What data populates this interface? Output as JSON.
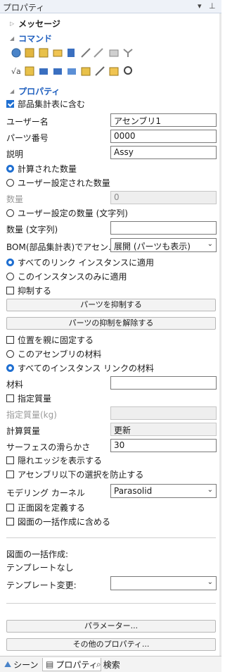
{
  "panel": {
    "title": "プロパティ",
    "pin_glyph": "▾ ⊥"
  },
  "sections": {
    "messages": "メッセージ",
    "commands": "コマンド",
    "properties": "プロパティ"
  },
  "icons_row1": [
    "globe-icon",
    "pencil-icon",
    "hierarchy-icon",
    "folder-icon",
    "chart-icon",
    "magic-icon",
    "strike-icon",
    "open-icon",
    "fork-icon"
  ],
  "icons_row2": [
    "sqrt-icon",
    "notes-icon",
    "link-icon",
    "constraint-icon",
    "bus-icon",
    "cube-icon",
    "brush-icon",
    "layers-icon",
    "zoom-icon"
  ],
  "props": {
    "include_bom": "部品集計表に含む",
    "user_name_label": "ユーザー名",
    "user_name_value": "アセンブリ1",
    "part_no_label": "パーツ番号",
    "part_no_value": "0000",
    "desc_label": "説明",
    "desc_value": "Assy",
    "calc_qty": "計算された数量",
    "user_qty": "ユーザー設定された数量",
    "qty_label": "数量",
    "qty_value": "0",
    "user_qty_str": "ユーザー設定の数量 (文字列)",
    "qty_str_label": "数量 (文字列)",
    "qty_str_value": "",
    "bom_label": "BOM(部品集計表)でアセン...",
    "bom_value": "展開 (パーツも表示)",
    "apply_all_links": "すべてのリンク インスタンスに適用",
    "apply_this": "このインスタンスのみに適用",
    "suppress": "抑制する",
    "suppress_parts_btn": "パーツを抑制する",
    "unsuppress_parts_btn": "パーツの抑制を解除する",
    "fix_to_parent": "位置を親に固定する",
    "this_asm_material": "このアセンブリの材料",
    "all_links_material": "すべてのインスタンス リンクの材料",
    "material_label": "材料",
    "material_value": "",
    "specified_mass": "指定質量",
    "specified_mass_label": "指定質量(kg)",
    "specified_mass_value": "",
    "calc_mass_label": "計算質量",
    "calc_mass_value": "更新",
    "surface_smooth_label": "サーフェスの滑らかさ",
    "surface_smooth_value": "30",
    "show_hidden_edges": "隠れエッジを表示する",
    "prevent_select_below": "アセンブリ以下の選択を防止する",
    "kernel_label": "モデリング カーネル",
    "kernel_value": "Parasolid",
    "define_front": "正面図を定義する",
    "include_batch": "図面の一括作成に含める",
    "batch_title": "図面の一括作成:",
    "no_template": "テンプレートなし",
    "change_template_label": "テンプレート変更:",
    "change_template_value": "",
    "params_btn": "パラメーター...",
    "other_props_btn": "その他のプロパティ..."
  },
  "tabs": {
    "scene": "シーン",
    "properties": "プロパティ",
    "search": "検索"
  },
  "colors": {
    "accent": "#1f6fd1",
    "section_blue": "#1f5fbf"
  }
}
